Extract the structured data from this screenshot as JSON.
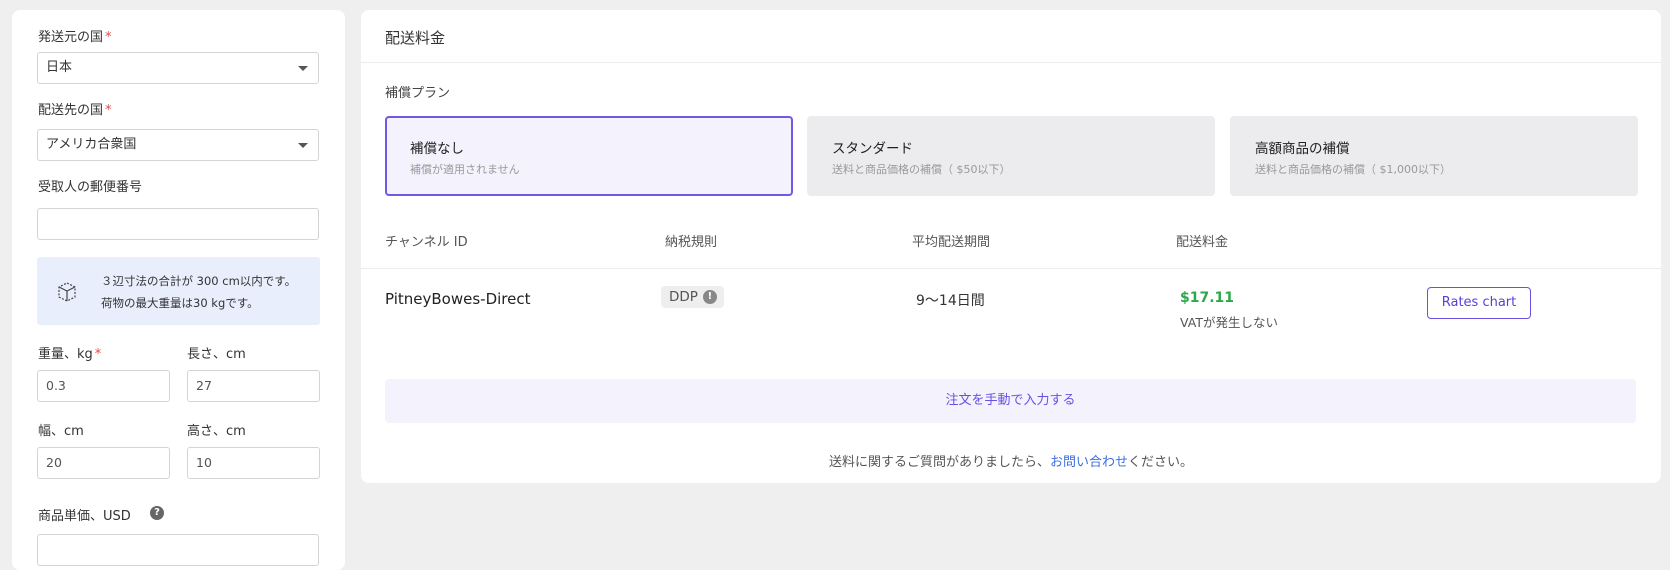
{
  "form": {
    "origin_label": "発送元の国",
    "origin_value": "日本",
    "destination_label": "配送先の国",
    "destination_value": "アメリカ合衆国",
    "zip_label": "受取人の郵便番号",
    "zip_value": "",
    "required_mark": "*",
    "info_line1": "３辺寸法の合計が 300 cm以内です。",
    "info_line2": "荷物の最大重量は30 kgです。",
    "weight_label": "重量、kg",
    "weight_value": "0.3",
    "length_label": "長さ、cm",
    "length_value": "27",
    "width_label": "幅、cm",
    "width_value": "20",
    "height_label": "高さ、cm",
    "height_value": "10",
    "price_label": "商品単価、USD",
    "price_value": "",
    "help_glyph": "?"
  },
  "rates": {
    "title": "配送料金",
    "plans_label": "補償プラン",
    "plans": [
      {
        "title": "補償なし",
        "desc": "補償が適用されません",
        "selected": true
      },
      {
        "title": "スタンダード",
        "desc": "送料と商品価格の補償（ $50以下）",
        "selected": false
      },
      {
        "title": "高額商品の補償",
        "desc": "送料と商品価格の補償（ $1,000以下）",
        "selected": false
      }
    ],
    "columns": [
      "チャンネル ID",
      "納税規則",
      "平均配送期間",
      "配送料金"
    ],
    "row": {
      "channel": "PitneyBowes-Direct",
      "tax_rule": "DDP",
      "tax_info_glyph": "!",
      "period": "9〜14日間",
      "price": "$17.11",
      "vat_note": "VATが発生しない",
      "button_label": "Rates chart"
    },
    "manual_entry_label": "注文を手動で入力する",
    "footer_prefix": "送料に関するご質問がありましたら、",
    "footer_link": "お問い合わせ",
    "footer_suffix": "ください。"
  },
  "colors": {
    "accent": "#6b4fe0",
    "price_green": "#2ba84a",
    "link_blue": "#3d6fe0",
    "required_red": "#e5484d",
    "info_bg": "#e8eefc"
  }
}
